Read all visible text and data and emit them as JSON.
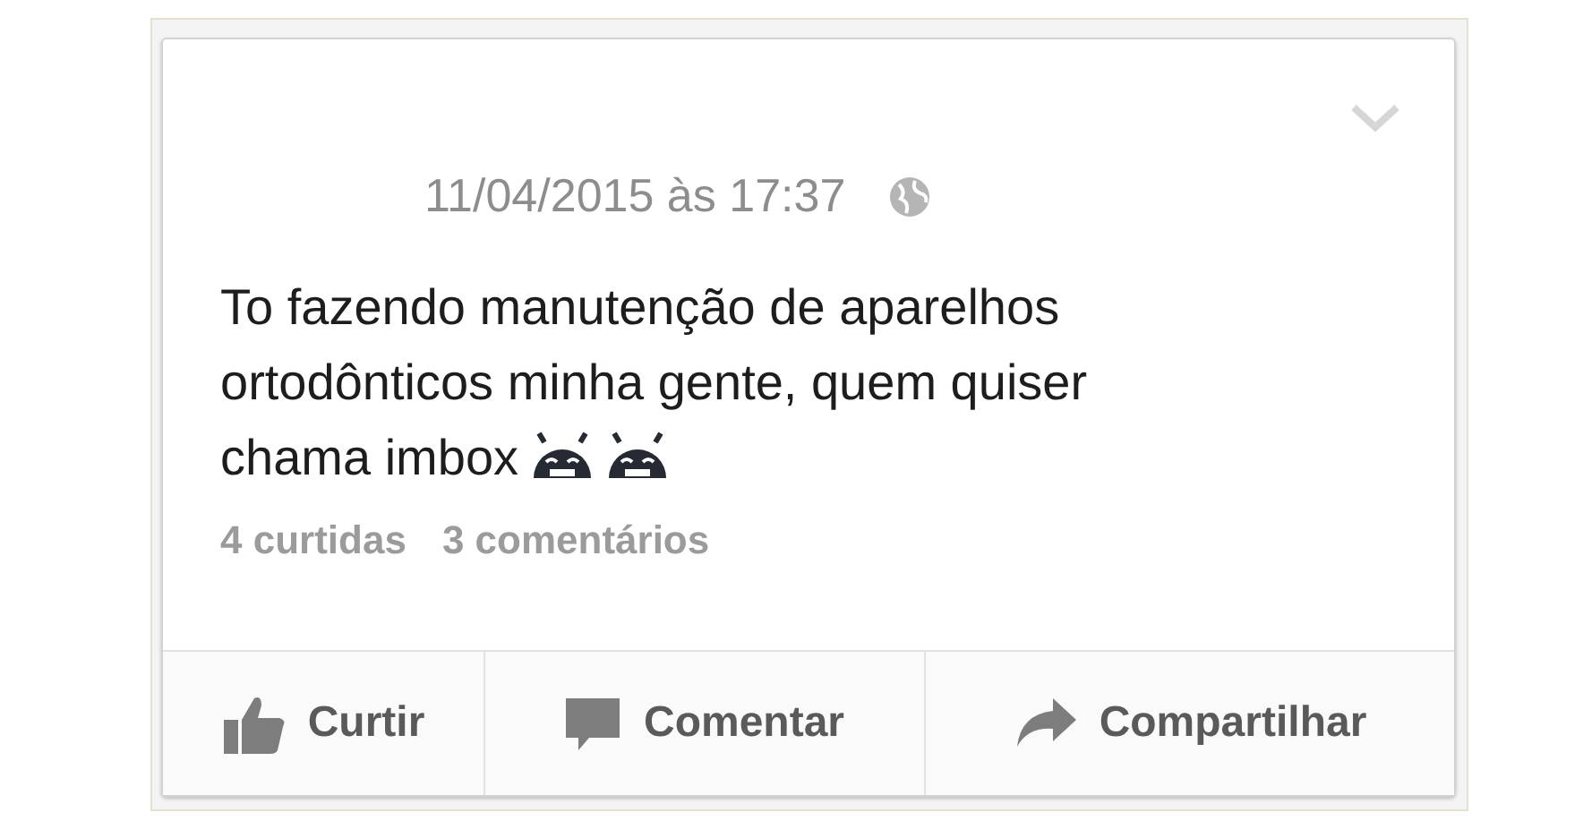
{
  "post": {
    "timestamp": "11/04/2015 às 17:37",
    "text_lines": [
      "To fazendo manutenção de aparelhos",
      "ortodônticos minha gente, quem quiser",
      "chama imbox"
    ],
    "emojis": [
      {
        "kind": "android"
      },
      {
        "kind": "android"
      }
    ],
    "likes": "4 curtidas",
    "comments": "3 comentários"
  },
  "actions": [
    {
      "kind": "like",
      "label": "Curtir"
    },
    {
      "kind": "comment",
      "label": "Comentar"
    },
    {
      "kind": "share",
      "label": "Compartilhar"
    }
  ]
}
